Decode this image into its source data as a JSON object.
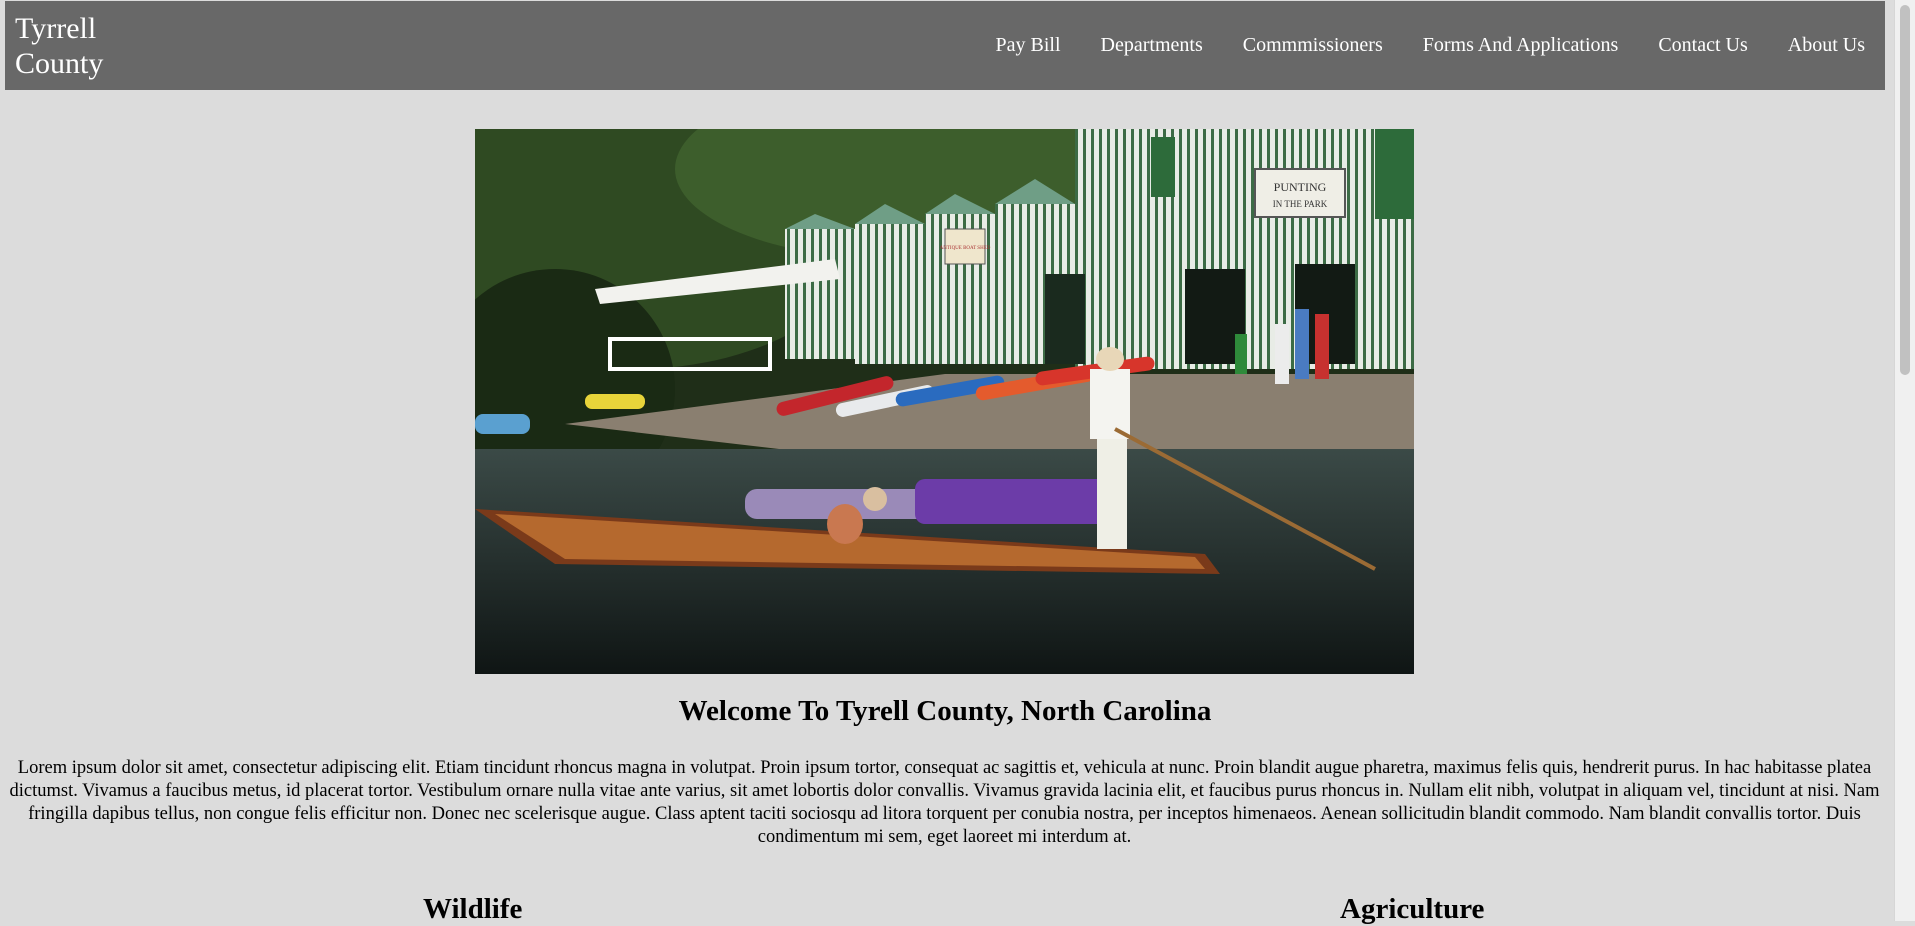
{
  "header": {
    "logo_text": "Tyrrell County",
    "nav": [
      {
        "label": "Pay Bill"
      },
      {
        "label": "Departments"
      },
      {
        "label": "Commmissioners"
      },
      {
        "label": "Forms And Applications"
      },
      {
        "label": "Contact Us"
      },
      {
        "label": "About Us"
      }
    ]
  },
  "hero": {
    "sign_top": "PUNTING",
    "sign_bottom": "IN THE PARK",
    "sign_small": "ANTIQUE BOAT SHED"
  },
  "main": {
    "welcome_title": "Welcome To Tyrell County, North Carolina",
    "intro_text": "Lorem ipsum dolor sit amet, consectetur adipiscing elit. Etiam tincidunt rhoncus magna in volutpat. Proin ipsum tortor, consequat ac sagittis et, vehicula at nunc. Proin blandit augue pharetra, maximus felis quis, hendrerit purus. In hac habitasse platea dictumst. Vivamus a faucibus metus, id placerat tortor. Vestibulum ornare nulla vitae ante varius, sit amet lobortis dolor convallis. Vivamus gravida lacinia elit, et faucibus purus rhoncus in. Nullam elit nibh, volutpat in aliquam vel, tincidunt at nisi. Nam fringilla dapibus tellus, non congue felis efficitur non. Donec nec scelerisque augue. Class aptent taciti sociosqu ad litora torquent per conubia nostra, per inceptos himenaeos. Aenean sollicitudin blandit commodo. Nam blandit convallis tortor. Duis condimentum mi sem, eget laoreet mi interdum at.",
    "sections": [
      {
        "title": "Wildlife"
      },
      {
        "title": "Agriculture"
      }
    ]
  }
}
